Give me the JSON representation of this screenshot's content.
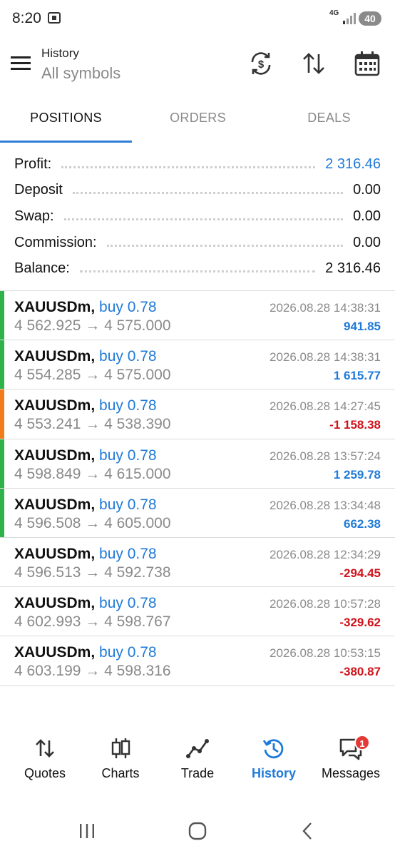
{
  "status_bar": {
    "time": "8:20",
    "network": "4G",
    "battery": "40"
  },
  "toolbar": {
    "title": "History",
    "subtitle": "All symbols"
  },
  "tabs": [
    {
      "label": "POSITIONS",
      "active": true
    },
    {
      "label": "ORDERS",
      "active": false
    },
    {
      "label": "DEALS",
      "active": false
    }
  ],
  "summary": [
    {
      "label": "Profit:",
      "value": "2 316.46",
      "highlight": true
    },
    {
      "label": "Deposit",
      "value": "0.00",
      "highlight": false
    },
    {
      "label": "Swap:",
      "value": "0.00",
      "highlight": false
    },
    {
      "label": "Commission:",
      "value": "0.00",
      "highlight": false
    },
    {
      "label": "Balance:",
      "value": "2 316.46",
      "highlight": false
    }
  ],
  "deals": [
    {
      "symbol": "XAUUSDm,",
      "side": "buy 0.78",
      "prices": "4 562.925 → 4 575.000",
      "time": "2026.08.28 14:38:31",
      "profit": "941.85",
      "profit_color": "#1f7ad8",
      "bar_color": "#2db34a"
    },
    {
      "symbol": "XAUUSDm,",
      "side": "buy 0.78",
      "prices": "4 554.285 → 4 575.000",
      "time": "2026.08.28 14:38:31",
      "profit": "1 615.77",
      "profit_color": "#1f7ad8",
      "bar_color": "#2db34a"
    },
    {
      "symbol": "XAUUSDm,",
      "side": "buy 0.78",
      "prices": "4 553.241 → 4 538.390",
      "time": "2026.08.28 14:27:45",
      "profit": "-1 158.38",
      "profit_color": "#d0131b",
      "bar_color": "#f07c1c"
    },
    {
      "symbol": "XAUUSDm,",
      "side": "buy 0.78",
      "prices": "4 598.849 → 4 615.000",
      "time": "2026.08.28 13:57:24",
      "profit": "1 259.78",
      "profit_color": "#1f7ad8",
      "bar_color": "#2db34a"
    },
    {
      "symbol": "XAUUSDm,",
      "side": "buy 0.78",
      "prices": "4 596.508 → 4 605.000",
      "time": "2026.08.28 13:34:48",
      "profit": "662.38",
      "profit_color": "#1f7ad8",
      "bar_color": "#2db34a"
    },
    {
      "symbol": "XAUUSDm,",
      "side": "buy 0.78",
      "prices": "4 596.513 → 4 592.738",
      "time": "2026.08.28 12:34:29",
      "profit": "-294.45",
      "profit_color": "#d0131b",
      "bar_color": "transparent"
    },
    {
      "symbol": "XAUUSDm,",
      "side": "buy 0.78",
      "prices": "4 602.993 → 4 598.767",
      "time": "2026.08.28 10:57:28",
      "profit": "-329.62",
      "profit_color": "#d0131b",
      "bar_color": "transparent"
    },
    {
      "symbol": "XAUUSDm,",
      "side": "buy 0.78",
      "prices": "4 603.199 → 4 598.316",
      "time": "2026.08.28 10:53:15",
      "profit": "-380.87",
      "profit_color": "#d0131b",
      "bar_color": "transparent"
    }
  ],
  "bottom_nav": [
    {
      "label": "Quotes",
      "icon": "quotes-icon",
      "active": false
    },
    {
      "label": "Charts",
      "icon": "charts-icon",
      "active": false
    },
    {
      "label": "Trade",
      "icon": "trade-icon",
      "active": false
    },
    {
      "label": "History",
      "icon": "history-icon",
      "active": true
    },
    {
      "label": "Messages",
      "icon": "messages-icon",
      "active": false,
      "badge": "1"
    }
  ],
  "colors": {
    "accent": "#1f7ad8",
    "loss": "#d0131b",
    "win_bar": "#2db34a",
    "loss_bar": "#f07c1c"
  }
}
